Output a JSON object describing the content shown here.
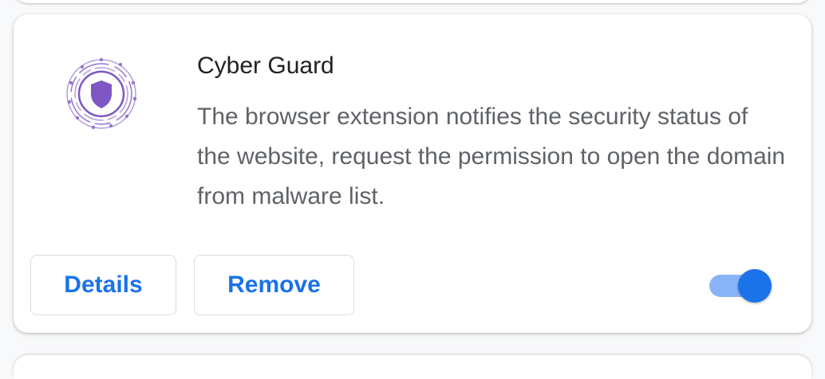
{
  "extension": {
    "name": "Cyber Guard",
    "description": "The browser extension notifies the security status of the website, request the permission to open the domain from malware list.",
    "icon": "shield-circuit-icon",
    "icon_color": "#7e57c2",
    "enabled": true
  },
  "buttons": {
    "details_label": "Details",
    "remove_label": "Remove"
  },
  "colors": {
    "accent": "#1a73e8",
    "toggle_track": "#8ab4f8",
    "title_text": "#202124",
    "body_text": "#5f6368"
  }
}
